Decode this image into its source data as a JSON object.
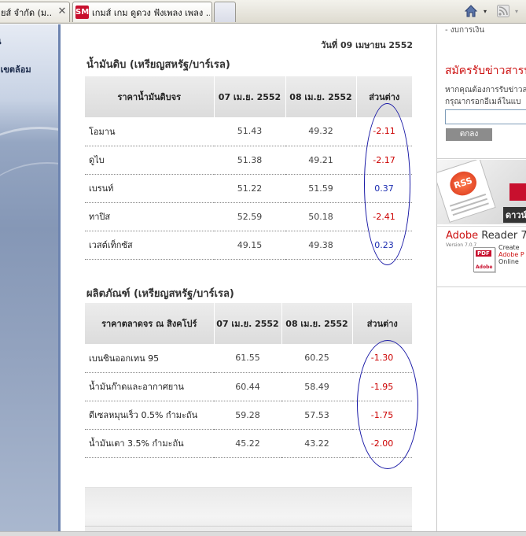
{
  "browser": {
    "tabs": [
      {
        "label": "ยส์ จำกัด (ม...",
        "close": "✕"
      },
      {
        "label": "เกมส์ เกม ดูดวง ฟังเพลง เพลง ...",
        "favicon": "SM"
      },
      {
        "label": ""
      }
    ],
    "toolbar": {
      "home_icon": "home-icon",
      "feeds_icon": "rss-feed-icon",
      "dropdown": "▾"
    }
  },
  "left_sidebar": {
    "items": [
      "น",
      "อเขตล้อม"
    ]
  },
  "main": {
    "date": "วันที่ 09 เมษายน 2552",
    "crude": {
      "title": "น้ำมันดิบ (เหรียญสหรัฐ/บาร์เรล)",
      "headers": [
        "ราคาน้ำมันดิบจร",
        "07 เม.ย. 2552",
        "08 เม.ย. 2552",
        "ส่วนต่าง"
      ],
      "rows": [
        {
          "name": "โอมาน",
          "d1": "51.43",
          "d2": "49.32",
          "diff": "-2.11"
        },
        {
          "name": "ดูไบ",
          "d1": "51.38",
          "d2": "49.21",
          "diff": "-2.17"
        },
        {
          "name": "เบรนท์",
          "d1": "51.22",
          "d2": "51.59",
          "diff": "0.37"
        },
        {
          "name": "ทาปิส",
          "d1": "52.59",
          "d2": "50.18",
          "diff": "-2.41"
        },
        {
          "name": "เวสต์เท็กซัส",
          "d1": "49.15",
          "d2": "49.38",
          "diff": "0.23"
        }
      ]
    },
    "products": {
      "title": "ผลิตภัณฑ์ (เหรียญสหรัฐ/บาร์เรล)",
      "headers": [
        "ราคาตลาดจร ณ สิงคโปร์",
        "07 เม.ย. 2552",
        "08 เม.ย. 2552",
        "ส่วนต่าง"
      ],
      "rows": [
        {
          "name": "เบนซินออกเทน 95",
          "d1": "61.55",
          "d2": "60.25",
          "diff": "-1.30"
        },
        {
          "name": "น้ำมันก๊าดและอากาศยาน",
          "d1": "60.44",
          "d2": "58.49",
          "diff": "-1.95"
        },
        {
          "name": "ดีเซลหมุนเร็ว 0.5% กำมะถัน",
          "d1": "59.28",
          "d2": "57.53",
          "diff": "-1.75"
        },
        {
          "name": "น้ำมันเตา 3.5% กำมะถัน",
          "d1": "45.22",
          "d2": "43.22",
          "diff": "-2.00"
        }
      ]
    },
    "colors": {
      "negative": "#cc0000",
      "positive": "#1a2bb0",
      "annotation": "#1a1aa6"
    }
  },
  "right_sidebar": {
    "top_text": "- งบการเงิน",
    "subscribe_title": "สมัครรับข่าวสารนัก",
    "desc_line1": "หากคุณต้องการรับข่าวส",
    "desc_line2": "กรุณากรอกอีเมล์ในแบ",
    "email_placeholder": "",
    "submit_label": "ตกลง",
    "rss": {
      "badge": "RSS",
      "download": "ดาวน์"
    },
    "adobe": {
      "brand": "Adobe",
      "product": " Reader",
      "suffix": " 7",
      "version": "Version 7.0.7",
      "pdf_label": "PDF",
      "pdf_brand": "Adobe",
      "line1": "Create",
      "line2": "Adobe P",
      "line3": "Online"
    }
  }
}
